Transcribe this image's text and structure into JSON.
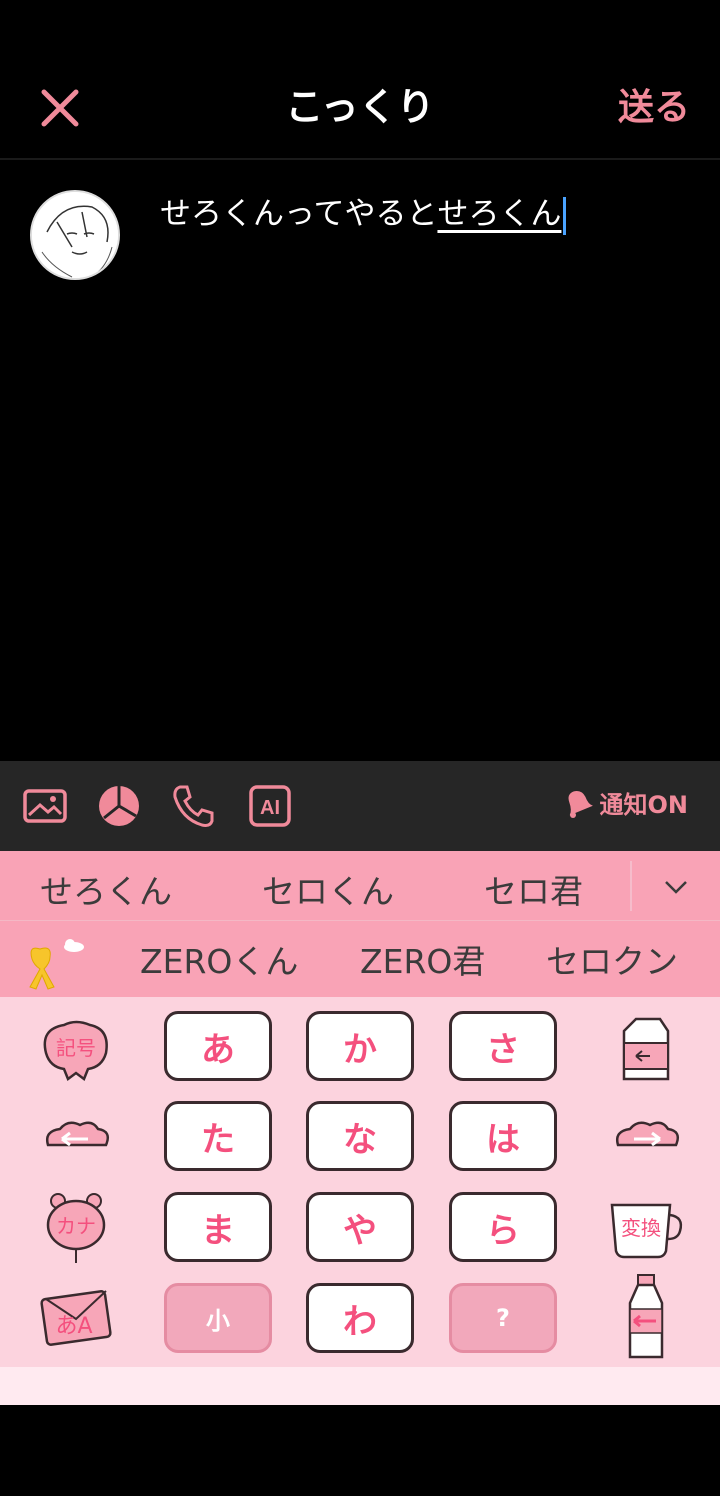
{
  "header": {
    "title": "こっくり",
    "send_label": "送る"
  },
  "compose": {
    "committed_text": "せろくんってやると",
    "composing_text": "せろくん"
  },
  "toolbar": {
    "notify_label": "通知ON"
  },
  "candidates": {
    "row1": [
      "せろくん",
      "セロくん",
      "セロ君"
    ],
    "row2": [
      "ZEROくん",
      "ZERO君",
      "セロクン"
    ]
  },
  "keyboard": {
    "keys": [
      "あ",
      "か",
      "さ",
      "た",
      "な",
      "は",
      "ま",
      "や",
      "ら",
      "小",
      "わ",
      "?"
    ],
    "side_labels": {
      "symbol": "記号",
      "kana": "カナ",
      "henkan": "変換",
      "mode": "あA"
    }
  },
  "colors": {
    "accent": "#f08a9a",
    "keyText": "#f4507e",
    "keyboardBg": "#fcd3de",
    "candidateBg": "#f9a3b6"
  }
}
